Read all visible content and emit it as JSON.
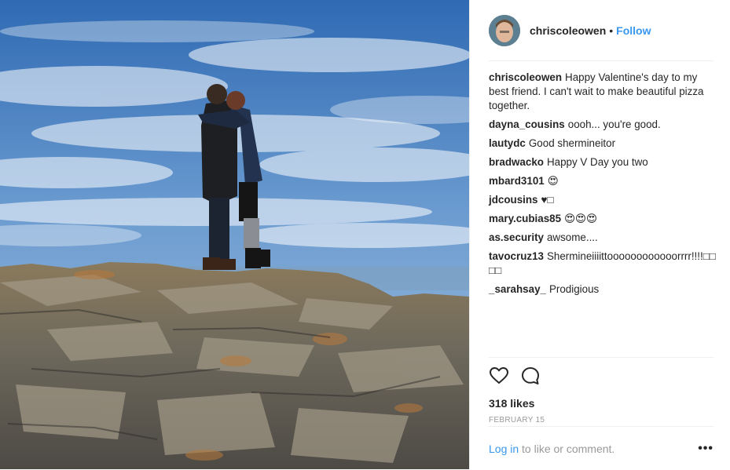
{
  "post": {
    "username": "chriscoleowen",
    "separator": "•",
    "follow_label": "Follow",
    "caption": {
      "user": "chriscoleowen",
      "text": "Happy Valentine's day to my best friend. I can't wait to make beautiful pizza together."
    },
    "comments": [
      {
        "user": "dayna_cousins",
        "text": "oooh... you're good."
      },
      {
        "user": "lautydc",
        "text": "Good shermineitor"
      },
      {
        "user": "bradwacko",
        "text": "Happy V Day you two"
      },
      {
        "user": "mbard3101",
        "text": "😍"
      },
      {
        "user": "jdcousins",
        "text": "♥□"
      },
      {
        "user": "mary.cubias85",
        "text": "😍😍😍"
      },
      {
        "user": "as.security",
        "text": "awsome...."
      },
      {
        "user": "tavocruz13",
        "text": "Shermineiiiittoooooooooooorrrr!!!!□□□□"
      },
      {
        "user": "_sarahsay_",
        "text": "Prodigious"
      }
    ],
    "likes_text": "318 likes",
    "date_text": "FEBRUARY 15",
    "login_link": "Log in",
    "login_rest": " to like or comment.",
    "more_label": "•••"
  },
  "icons": {
    "like": "heart-outline-icon",
    "comment": "speech-bubble-icon",
    "more": "ellipsis-icon"
  },
  "colors": {
    "link": "#3897f0",
    "text": "#262626",
    "muted": "#999999",
    "divider": "#efefef",
    "sky": "#3d78b8"
  }
}
